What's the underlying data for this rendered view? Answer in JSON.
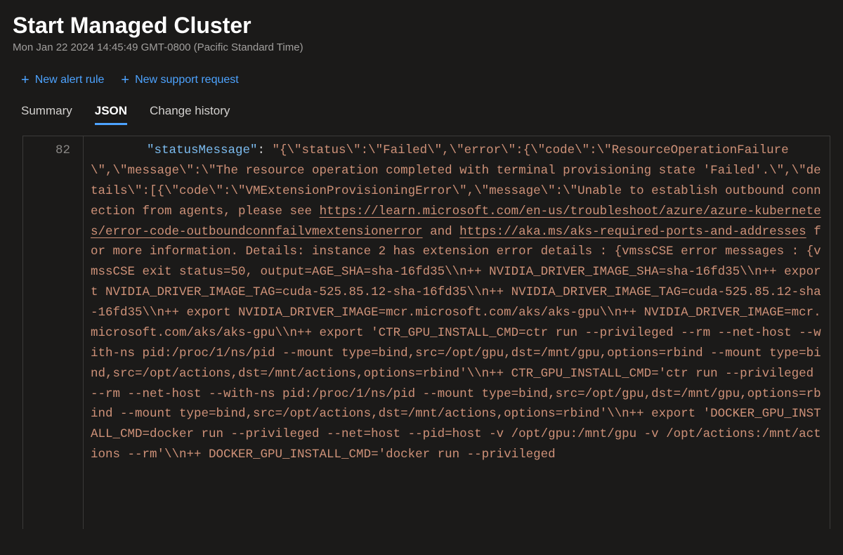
{
  "header": {
    "title": "Start Managed Cluster",
    "subtitle": "Mon Jan 22 2024 14:45:49 GMT-0800 (Pacific Standard Time)"
  },
  "actions": {
    "new_alert_rule": "New alert rule",
    "new_support_request": "New support request"
  },
  "tabs": {
    "summary": "Summary",
    "json": "JSON",
    "change_history": "Change history"
  },
  "json": {
    "line_number": "82",
    "key": "\"statusMessage\"",
    "pre_link1": "\"{\\\"status\\\":\\\"Failed\\\",\\\"error\\\":{\\\"code\\\":\\\"ResourceOperationFailure\\\",\\\"message\\\":\\\"The resource operation completed with terminal provisioning state 'Failed'.\\\",\\\"details\\\":[{\\\"code\\\":\\\"VMExtensionProvisioningError\\\",\\\"message\\\":\\\"Unable to establish outbound connection from agents, please see ",
    "link1": "https://learn.microsoft.com/en-us/troubleshoot/azure/azure-kubernetes/error-code-outboundconnfailvmextensionerror",
    "mid1": " and ",
    "link2": "https://aka.ms/aks-required-ports-and-addresses",
    "post_links": " for more information. Details: instance 2 has extension error details : {vmssCSE error messages : {vmssCSE exit status=50, output=AGE_SHA=sha-16fd35\\\\n++ NVIDIA_DRIVER_IMAGE_SHA=sha-16fd35\\\\n++ export NVIDIA_DRIVER_IMAGE_TAG=cuda-525.85.12-sha-16fd35\\\\n++ NVIDIA_DRIVER_IMAGE_TAG=cuda-525.85.12-sha-16fd35\\\\n++ export NVIDIA_DRIVER_IMAGE=mcr.microsoft.com/aks/aks-gpu\\\\n++ NVIDIA_DRIVER_IMAGE=mcr.microsoft.com/aks/aks-gpu\\\\n++ export 'CTR_GPU_INSTALL_CMD=ctr run --privileged --rm --net-host --with-ns pid:/proc/1/ns/pid --mount type=bind,src=/opt/gpu,dst=/mnt/gpu,options=rbind --mount type=bind,src=/opt/actions,dst=/mnt/actions,options=rbind'\\\\n++ CTR_GPU_INSTALL_CMD='ctr run --privileged --rm --net-host --with-ns pid:/proc/1/ns/pid --mount type=bind,src=/opt/gpu,dst=/mnt/gpu,options=rbind --mount type=bind,src=/opt/actions,dst=/mnt/actions,options=rbind'\\\\n++ export 'DOCKER_GPU_INSTALL_CMD=docker run --privileged --net=host --pid=host -v /opt/gpu:/mnt/gpu -v /opt/actions:/mnt/actions --rm'\\\\n++ DOCKER_GPU_INSTALL_CMD='docker run --privileged"
  }
}
